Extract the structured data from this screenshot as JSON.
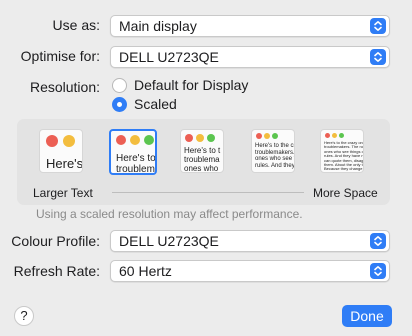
{
  "use_as": {
    "label": "Use as:",
    "value": "Main display"
  },
  "optimise_for": {
    "label": "Optimise for:",
    "value": "DELL U2723QE"
  },
  "resolution": {
    "label": "Resolution:",
    "options": [
      {
        "label": "Default for Display",
        "selected": false
      },
      {
        "label": "Scaled",
        "selected": true
      }
    ]
  },
  "scale": {
    "left_label": "Larger Text",
    "right_label": "More Space",
    "selected_index": 1,
    "thumb_texts": [
      "Here's",
      "Here's to\ntroublem",
      "Here's to t\ntroublema\nones who",
      "Here's to the cr\ntroublemakers.\nones who see t\nrules. And they",
      "Here's to the crazy one\ntroublemakers. The rou\nones who see things di\nrules. And they have no\ncan quote them, disagr\nthem. About the only th\nBecause they change t"
    ]
  },
  "hint": "Using a scaled resolution may affect performance.",
  "colour_profile": {
    "label": "Colour Profile:",
    "value": "DELL U2723QE"
  },
  "refresh_rate": {
    "label": "Refresh Rate:",
    "value": "60 Hertz"
  },
  "buttons": {
    "help": "?",
    "done": "Done"
  },
  "colors": {
    "accent": "#2f7df6",
    "red": "#ec5f54",
    "yellow": "#f3bd3e",
    "green": "#5bc54f"
  },
  "icons": {
    "popup_chevron": "chevron-up-down-icon",
    "help": "question-icon"
  }
}
